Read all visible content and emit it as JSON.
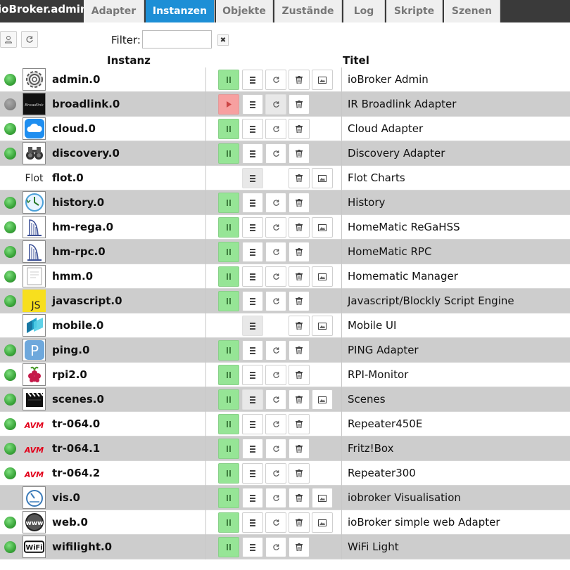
{
  "app": {
    "brand": "ioBroker.admin"
  },
  "tabs": [
    {
      "label": "Adapter"
    },
    {
      "label": "Instanzen"
    },
    {
      "label": "Objekte"
    },
    {
      "label": "Zustände"
    },
    {
      "label": "Log"
    },
    {
      "label": "Skripte"
    },
    {
      "label": "Szenen"
    }
  ],
  "toolbar": {
    "filter_label": "Filter:",
    "filter_value": "",
    "clear_glyph": "✖"
  },
  "table": {
    "headers": {
      "instance": "Instanz",
      "title": "Titel"
    },
    "rows": [
      {
        "name": "admin.0",
        "title": "ioBroker Admin",
        "icon": "gear-icon",
        "led": "green",
        "state": "running",
        "buttons": [
          "run",
          "config",
          "reload",
          "delete",
          "web"
        ]
      },
      {
        "name": "broadlink.0",
        "title": "IR Broadlink Adapter",
        "icon": "broadlink-icon",
        "led": "gray",
        "state": "stopped",
        "buttons": [
          "stopped",
          "config",
          "reload-disabled",
          "delete"
        ]
      },
      {
        "name": "cloud.0",
        "title": "Cloud Adapter",
        "icon": "cloud-icon",
        "led": "green",
        "state": "running",
        "buttons": [
          "run",
          "config",
          "reload",
          "delete"
        ]
      },
      {
        "name": "discovery.0",
        "title": "Discovery Adapter",
        "icon": "binoculars-icon",
        "led": "green",
        "state": "running",
        "buttons": [
          "run",
          "config",
          "reload",
          "delete"
        ]
      },
      {
        "name": "flot.0",
        "title": "Flot Charts",
        "icon": "flot-icon",
        "icon_text": "Flot",
        "led": "none",
        "state": "none",
        "buttons": [
          "config-disabled",
          "delete",
          "web"
        ]
      },
      {
        "name": "history.0",
        "title": "History",
        "icon": "clock-icon",
        "led": "green",
        "state": "running",
        "buttons": [
          "run",
          "config",
          "reload",
          "delete"
        ]
      },
      {
        "name": "hm-rega.0",
        "title": "HomeMatic ReGaHSS",
        "icon": "homematic-icon",
        "led": "green",
        "state": "running",
        "buttons": [
          "run",
          "config",
          "reload",
          "delete",
          "web"
        ]
      },
      {
        "name": "hm-rpc.0",
        "title": "HomeMatic RPC",
        "icon": "homematic-icon",
        "led": "green",
        "state": "running",
        "buttons": [
          "run",
          "config",
          "reload",
          "delete"
        ]
      },
      {
        "name": "hmm.0",
        "title": "Homematic Manager",
        "icon": "document-icon",
        "led": "green",
        "state": "running",
        "buttons": [
          "run",
          "config",
          "reload",
          "delete",
          "web"
        ]
      },
      {
        "name": "javascript.0",
        "title": "Javascript/Blockly Script Engine",
        "icon": "javascript-icon",
        "icon_text": "JS",
        "led": "green",
        "state": "running",
        "buttons": [
          "run",
          "config",
          "reload",
          "delete"
        ]
      },
      {
        "name": "mobile.0",
        "title": "Mobile UI",
        "icon": "mobile-icon",
        "led": "none",
        "state": "none",
        "buttons": [
          "config-disabled",
          "delete",
          "web"
        ]
      },
      {
        "name": "ping.0",
        "title": "PING Adapter",
        "icon": "ping-icon",
        "icon_text": "P",
        "led": "green",
        "state": "running",
        "buttons": [
          "run",
          "config",
          "reload",
          "delete"
        ]
      },
      {
        "name": "rpi2.0",
        "title": "RPI-Monitor",
        "icon": "raspberry-icon",
        "led": "green",
        "state": "running",
        "buttons": [
          "run",
          "config",
          "reload",
          "delete"
        ]
      },
      {
        "name": "scenes.0",
        "title": "Scenes",
        "icon": "clapperboard-icon",
        "led": "green",
        "state": "running",
        "buttons": [
          "run",
          "config-disabled",
          "reload",
          "delete",
          "web"
        ]
      },
      {
        "name": "tr-064.0",
        "title": "Repeater450E",
        "icon": "avm-icon",
        "icon_text": "AVM",
        "led": "green",
        "state": "running",
        "buttons": [
          "run",
          "config",
          "reload",
          "delete"
        ]
      },
      {
        "name": "tr-064.1",
        "title": "Fritz!Box",
        "icon": "avm-icon",
        "icon_text": "AVM",
        "led": "green",
        "state": "running",
        "buttons": [
          "run",
          "config",
          "reload",
          "delete"
        ]
      },
      {
        "name": "tr-064.2",
        "title": "Repeater300",
        "icon": "avm-icon",
        "icon_text": "AVM",
        "led": "green",
        "state": "running",
        "buttons": [
          "run",
          "config",
          "reload",
          "delete"
        ]
      },
      {
        "name": "vis.0",
        "title": "iobroker Visualisation",
        "icon": "gauge-icon",
        "led": "none",
        "state": "running",
        "buttons": [
          "run",
          "config",
          "reload",
          "delete",
          "web"
        ]
      },
      {
        "name": "web.0",
        "title": "ioBroker simple web Adapter",
        "icon": "www-icon",
        "icon_text": "www",
        "led": "green",
        "state": "running",
        "buttons": [
          "run",
          "config",
          "reload",
          "delete",
          "web"
        ]
      },
      {
        "name": "wifilight.0",
        "title": "WiFi Light",
        "icon": "wifi-icon",
        "icon_text": "WiFi",
        "led": "green",
        "state": "running",
        "buttons": [
          "run",
          "config",
          "reload",
          "delete"
        ]
      }
    ]
  },
  "colors": {
    "active_tab": "#1d8fd6",
    "running": "#96e596",
    "stopped": "#f7a0a0",
    "row_alt": "#cdcdcd",
    "led_green": "#3aa53a"
  }
}
